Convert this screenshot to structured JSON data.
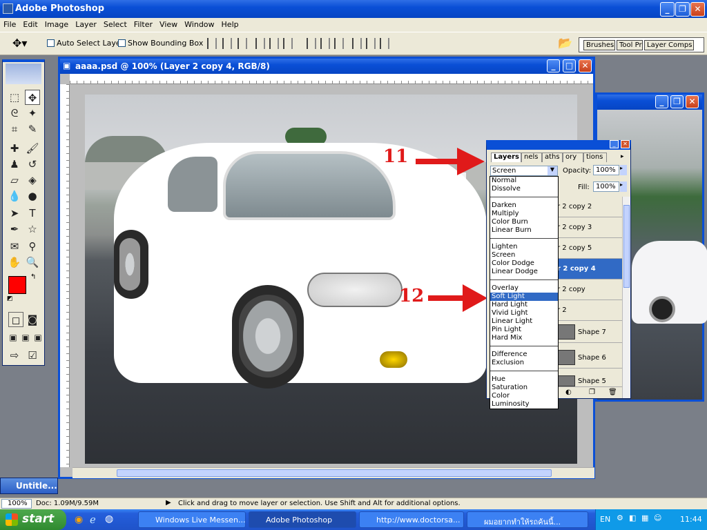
{
  "app": {
    "title": "Adobe Photoshop"
  },
  "menu": [
    "File",
    "Edit",
    "Image",
    "Layer",
    "Select",
    "Filter",
    "View",
    "Window",
    "Help"
  ],
  "options": {
    "auto_select": "Auto Select Layer",
    "bounding_box": "Show Bounding Box"
  },
  "palette_well": {
    "tabs": [
      "Brushes",
      "Tool Pr",
      "Layer Comps"
    ]
  },
  "toolbox": {
    "fg_color": "#ff0000",
    "bg_color": "#ffffff"
  },
  "document": {
    "title": "aaaa.psd @ 100% (Layer 2 copy 4, RGB/8)"
  },
  "background_doc": {
    "title": "Untitle..."
  },
  "layers_panel": {
    "tabs": [
      "Layers",
      "nels",
      "aths",
      "ory",
      "tions"
    ],
    "blend_mode": "Screen",
    "opacity_label": "Opacity:",
    "opacity": "100%",
    "fill_label": "Fill:",
    "fill": "100%",
    "rows": [
      "r 2 copy 2",
      "r 2 copy 3",
      "r 2 copy 5",
      "r 2 copy 4",
      "r 2 copy",
      "r 2",
      "Shape 7",
      "Shape 6",
      "Shape 5"
    ],
    "active_row": "r 2 copy 4"
  },
  "blend_menu": {
    "groups": [
      [
        "Normal",
        "Dissolve"
      ],
      [
        "Darken",
        "Multiply",
        "Color Burn",
        "Linear Burn"
      ],
      [
        "Lighten",
        "Screen",
        "Color Dodge",
        "Linear Dodge"
      ],
      [
        "Overlay",
        "Soft Light",
        "Hard Light",
        "Vivid Light",
        "Linear Light",
        "Pin Light",
        "Hard Mix"
      ],
      [
        "Difference",
        "Exclusion"
      ],
      [
        "Hue",
        "Saturation",
        "Color",
        "Luminosity"
      ]
    ],
    "highlighted": "Soft Light"
  },
  "annotations": {
    "arrow1": "11",
    "arrow2": "12"
  },
  "status": {
    "zoom": "100%",
    "doc": "Doc: 1.09M/9.59M",
    "hint": "Click and drag to move layer or selection.  Use Shift and Alt for additional options."
  },
  "taskbar": {
    "start": "start",
    "tasks": [
      "Windows Live Messen...",
      "Adobe Photoshop",
      "http://www.doctorsa...",
      "ผมอยากทำให้รถค้นนี้..."
    ],
    "lang": "EN",
    "clock": "11:44"
  }
}
